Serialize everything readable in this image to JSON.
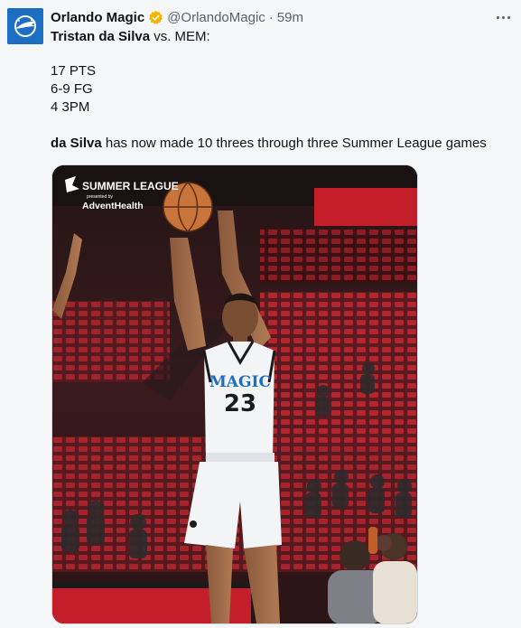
{
  "account": {
    "display_name": "Orlando Magic",
    "handle": "@OrlandoMagic",
    "separator": "·",
    "time": "59m",
    "verified_badge_color": "#f5b400",
    "brand_color": "#1b6ec2"
  },
  "post": {
    "line1_name": "Tristan da Silva",
    "line1_rest": " vs. MEM:",
    "stats": [
      "17 PTS",
      "6-9 FG",
      "4 3PM"
    ],
    "line3_name": "da Silva",
    "line3_rest": " has now made 10 threes through three Summer League games"
  },
  "media": {
    "logo_line1": "SUMMER LEAGUE",
    "logo_line2": "presented by",
    "logo_line3": "AdventHealth",
    "jersey_team": "MAGIC",
    "jersey_number": "23"
  },
  "icons": {
    "avatar": "orlando-magic-logo-icon",
    "verified": "verified-badge-icon",
    "more": "more-options-icon"
  }
}
